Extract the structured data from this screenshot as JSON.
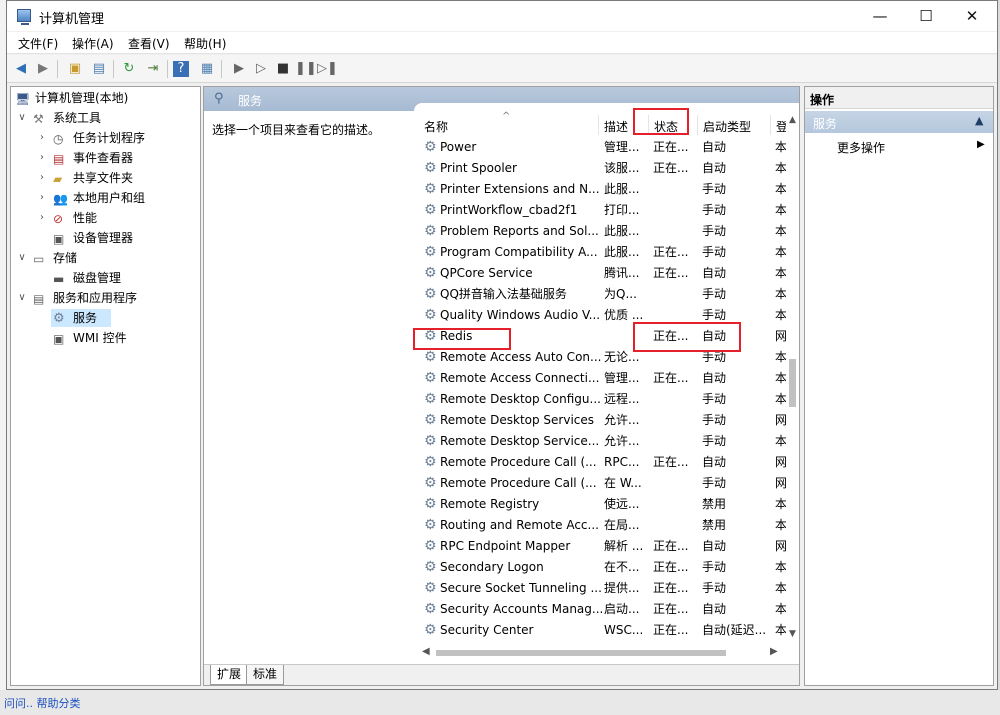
{
  "background": {
    "bottom_text": "问问.. 帮助分类"
  },
  "window": {
    "title": "计算机管理",
    "buttons": {
      "minimize": "—",
      "maximize": "☐",
      "close": "✕"
    }
  },
  "menu": [
    "文件(F)",
    "操作(A)",
    "查看(V)",
    "帮助(H)"
  ],
  "tree": {
    "root": "计算机管理(本地)",
    "system_tools": "系统工具",
    "task_scheduler": "任务计划程序",
    "event_viewer": "事件查看器",
    "shared_folders": "共享文件夹",
    "local_users": "本地用户和组",
    "performance": "性能",
    "device_manager": "设备管理器",
    "storage": "存储",
    "disk_management": "磁盘管理",
    "services_apps": "服务和应用程序",
    "services": "服务",
    "wmi": "WMI 控件"
  },
  "middle": {
    "header": "服务",
    "description": "选择一个项目来查看它的描述。",
    "columns": {
      "name": "名称",
      "desc": "描述",
      "state": "状态",
      "start": "启动类型",
      "login": "登"
    },
    "rows": [
      {
        "name": "Power",
        "desc": "管理...",
        "state": "正在...",
        "start": "自动",
        "login": "本"
      },
      {
        "name": "Print Spooler",
        "desc": "该服...",
        "state": "正在...",
        "start": "自动",
        "login": "本"
      },
      {
        "name": "Printer Extensions and N...",
        "desc": "此服...",
        "state": "",
        "start": "手动",
        "login": "本"
      },
      {
        "name": "PrintWorkflow_cbad2f1",
        "desc": "打印...",
        "state": "",
        "start": "手动",
        "login": "本"
      },
      {
        "name": "Problem Reports and Sol...",
        "desc": "此服...",
        "state": "",
        "start": "手动",
        "login": "本"
      },
      {
        "name": "Program Compatibility A...",
        "desc": "此服...",
        "state": "正在...",
        "start": "手动",
        "login": "本"
      },
      {
        "name": "QPCore Service",
        "desc": "腾讯...",
        "state": "正在...",
        "start": "自动",
        "login": "本"
      },
      {
        "name": "QQ拼音输入法基础服务",
        "desc": "为Q...",
        "state": "",
        "start": "手动",
        "login": "本"
      },
      {
        "name": "Quality Windows Audio V...",
        "desc": "优质 ...",
        "state": "",
        "start": "手动",
        "login": "本"
      },
      {
        "name": "Redis",
        "desc": "",
        "state": "正在...",
        "start": "自动",
        "login": "网"
      },
      {
        "name": "Remote Access Auto Con...",
        "desc": "无论...",
        "state": "",
        "start": "手动",
        "login": "本"
      },
      {
        "name": "Remote Access Connecti...",
        "desc": "管理...",
        "state": "正在...",
        "start": "自动",
        "login": "本"
      },
      {
        "name": "Remote Desktop Configu...",
        "desc": "远程...",
        "state": "",
        "start": "手动",
        "login": "本"
      },
      {
        "name": "Remote Desktop Services",
        "desc": "允许...",
        "state": "",
        "start": "手动",
        "login": "网"
      },
      {
        "name": "Remote Desktop Service...",
        "desc": "允许...",
        "state": "",
        "start": "手动",
        "login": "本"
      },
      {
        "name": "Remote Procedure Call (...",
        "desc": "RPC...",
        "state": "正在...",
        "start": "自动",
        "login": "网"
      },
      {
        "name": "Remote Procedure Call (...",
        "desc": "在 W...",
        "state": "",
        "start": "手动",
        "login": "网"
      },
      {
        "name": "Remote Registry",
        "desc": "使远...",
        "state": "",
        "start": "禁用",
        "login": "本"
      },
      {
        "name": "Routing and Remote Acc...",
        "desc": "在局...",
        "state": "",
        "start": "禁用",
        "login": "本"
      },
      {
        "name": "RPC Endpoint Mapper",
        "desc": "解析 ...",
        "state": "正在...",
        "start": "自动",
        "login": "网"
      },
      {
        "name": "Secondary Logon",
        "desc": "在不...",
        "state": "正在...",
        "start": "手动",
        "login": "本"
      },
      {
        "name": "Secure Socket Tunneling ...",
        "desc": "提供...",
        "state": "正在...",
        "start": "手动",
        "login": "本"
      },
      {
        "name": "Security Accounts Manag...",
        "desc": "启动...",
        "state": "正在...",
        "start": "自动",
        "login": "本"
      },
      {
        "name": "Security Center",
        "desc": "WSC...",
        "state": "正在...",
        "start": "自动(延迟...",
        "login": "本"
      }
    ],
    "tabs": [
      "扩展",
      "标准"
    ]
  },
  "actions": {
    "title": "操作",
    "section": "服务",
    "more": "更多操作"
  },
  "colors": {
    "highlight": "#e5202a",
    "selection": "#cce8ff",
    "header": "#a6bad2"
  }
}
